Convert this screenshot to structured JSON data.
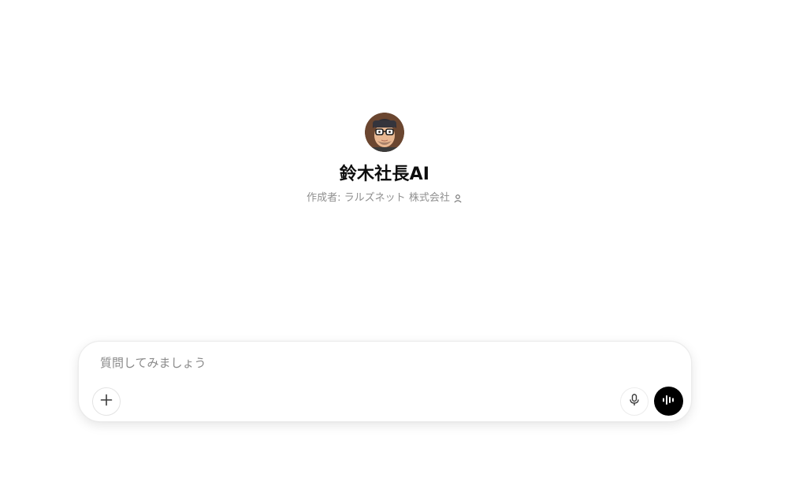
{
  "gpt": {
    "name": "鈴木社長AI",
    "author": "作成者: ラルズネット 株式会社",
    "avatar_icon": "memoji-avatar-with-glasses"
  },
  "composer": {
    "placeholder": "質問してみましょう",
    "value": "",
    "attach_icon": "plus-icon",
    "dictate_icon": "microphone-icon",
    "voice_icon": "voice-waveform-icon"
  },
  "colors": {
    "background": "#ffffff",
    "title_text": "#0d0d0d",
    "muted_text": "#8f8f8f",
    "voice_button": "#000000"
  }
}
